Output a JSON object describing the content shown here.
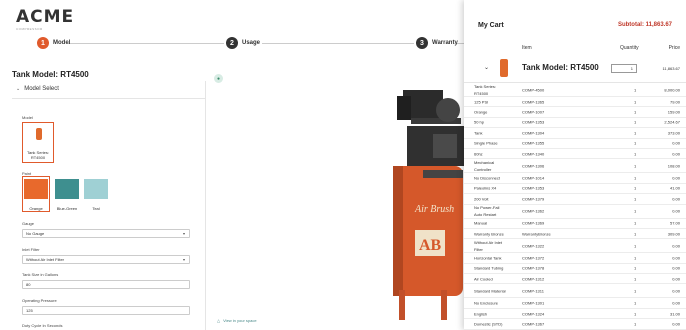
{
  "brand": {
    "logo_text": "ACME",
    "logo_sub": "COMPRESSOR"
  },
  "steps": [
    {
      "num": "1",
      "label": "Model",
      "color": "#e05a2c"
    },
    {
      "num": "2",
      "label": "Usage",
      "color": "#333333"
    },
    {
      "num": "3",
      "label": "Warranty",
      "color": "#333333"
    }
  ],
  "configurator": {
    "title": "Tank Model: RT4500",
    "section": "Model Select",
    "model_label": "Model",
    "model_card": "Tank Series: RT4500",
    "paint_label": "Paint",
    "paints": [
      {
        "name": "Orange",
        "color": "#e8692c"
      },
      {
        "name": "Blue-Green",
        "color": "#3e8f8f"
      },
      {
        "name": "Teal",
        "color": "#9fd0d4"
      }
    ],
    "gauge_label": "Gauge",
    "gauge_value": "No Gauge",
    "inlet_label": "Inlet Filter",
    "inlet_value": "Without Air Inlet Filter",
    "tank_size_label": "Tank Size in Gallons",
    "tank_size_value": "80",
    "pressure_label": "Operating Pressure",
    "pressure_value": "125",
    "duty_label": "Duty Cycle In Seconds"
  },
  "viewer": {
    "view_space": "View in your space",
    "product_logo_text": "Air Brush",
    "product_badge": "AB"
  },
  "cart": {
    "title": "My Cart",
    "subtotal": "Subtotal: 11,863.67",
    "col_item": "Item",
    "col_qty": "Quantity",
    "col_price": "Price",
    "main_item": {
      "name": "Tank Model: RT4500",
      "qty": "1",
      "price": "11,863.67"
    },
    "lines": [
      {
        "name": "Tank Series: RT4500",
        "code": "COMP-4500",
        "qty": "1",
        "price": "8,000.00"
      },
      {
        "name": "125 PSI",
        "code": "COMP-1365",
        "qty": "1",
        "price": "79.00"
      },
      {
        "name": "Orange",
        "code": "COMP-1007",
        "qty": "1",
        "price": "159.00"
      },
      {
        "name": "50 hp",
        "code": "COMP-1353",
        "qty": "1",
        "price": "2,524.67"
      },
      {
        "name": "Tank",
        "code": "COMP-1304",
        "qty": "1",
        "price": "373.00"
      },
      {
        "name": "Single Phase",
        "code": "COMP-1355",
        "qty": "1",
        "price": "0.00"
      },
      {
        "name": "60hz",
        "code": "COMP-1340",
        "qty": "1",
        "price": "0.00"
      },
      {
        "name": "Mechanical Controller",
        "code": "COMP-1306",
        "qty": "1",
        "price": "108.00"
      },
      {
        "name": "No Disconnect",
        "code": "COMP-1014",
        "qty": "1",
        "price": "0.00"
      },
      {
        "name": "Paleolins X4",
        "code": "COMP-1353",
        "qty": "1",
        "price": "41.00"
      },
      {
        "name": "200 Volt",
        "code": "COMP-1379",
        "qty": "1",
        "price": "0.00"
      },
      {
        "name": "No Power-Fail Auto Restart",
        "code": "COMP-1362",
        "qty": "1",
        "price": "0.00"
      },
      {
        "name": "Manual",
        "code": "COMP-1369",
        "qty": "1",
        "price": "57.00"
      },
      {
        "name": "Warranty Bronze",
        "code": "WarrantyBronze",
        "qty": "1",
        "price": "309.00"
      },
      {
        "name": "Without Air Inlet Filter",
        "code": "COMP-1322",
        "qty": "1",
        "price": "0.00"
      },
      {
        "name": "Horizontal Tank",
        "code": "COMP-1372",
        "qty": "1",
        "price": "0.00"
      },
      {
        "name": "Standard Tubing",
        "code": "COMP-1378",
        "qty": "1",
        "price": "0.00"
      },
      {
        "name": "Air Cooled",
        "code": "COMP-1312",
        "qty": "1",
        "price": "0.00"
      },
      {
        "name": "Standard Material",
        "code": "COMP-1311",
        "qty": "1",
        "price": "0.00"
      },
      {
        "name": "No Enclosure",
        "code": "COMP-1301",
        "qty": "1",
        "price": "0.00"
      },
      {
        "name": "English",
        "code": "COMP-1324",
        "qty": "1",
        "price": "31.00"
      },
      {
        "name": "Domestic (STD)",
        "code": "COMP-1367",
        "qty": "1",
        "price": "0.00"
      }
    ]
  }
}
